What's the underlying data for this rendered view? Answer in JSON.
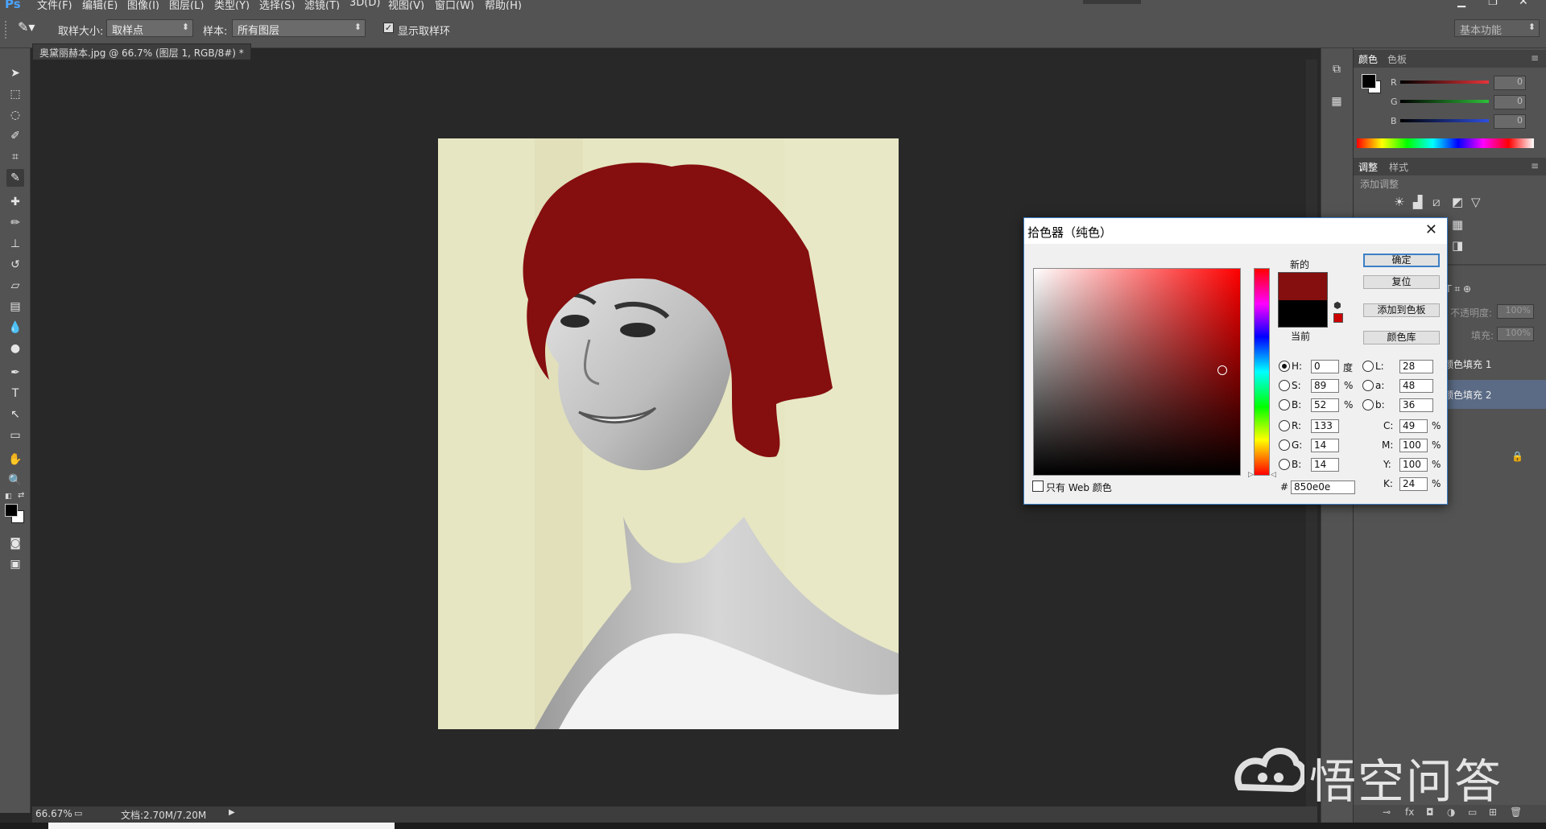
{
  "menu": {
    "logo": "Ps",
    "items": [
      "文件(F)",
      "编辑(E)",
      "图像(I)",
      "图层(L)",
      "类型(Y)",
      "选择(S)",
      "滤镜(T)",
      "3D(D)",
      "视图(V)",
      "窗口(W)",
      "帮助(H)"
    ]
  },
  "options": {
    "sample_size_label": "取样大小:",
    "sample_size_value": "取样点",
    "sample_label": "样本:",
    "sample_value": "所有图层",
    "show_ring_label": "显示取样环",
    "workspace": "基本功能"
  },
  "document": {
    "tab_title": "奥黛丽赫本.jpg @ 66.7% (图层 1, RGB/8#) *",
    "tab_close": "×",
    "zoom": "66.67%",
    "doc_info": "文档:2.70M/7.20M"
  },
  "color_panel": {
    "tabs": [
      "颜色",
      "色板"
    ],
    "channels": [
      {
        "label": "R",
        "value": "0",
        "color": "#e8343a"
      },
      {
        "label": "G",
        "value": "0",
        "color": "#2fbf3a"
      },
      {
        "label": "B",
        "value": "0",
        "color": "#2e4fe0"
      }
    ]
  },
  "adjust_panel": {
    "tabs": [
      "调整",
      "样式"
    ],
    "hint": "添加调整"
  },
  "layers_panel": {
    "opacity_label": "不透明度:",
    "opacity_value": "100%",
    "fill_label": "填充:",
    "fill_value": "100%",
    "layers": [
      "颜色填充 1",
      "颜色填充 2"
    ]
  },
  "color_picker": {
    "title": "拾色器（纯色）",
    "close": "✕",
    "new_label": "新的",
    "current_label": "当前",
    "new_color": "#850e0e",
    "current_color": "#000000",
    "buttons": {
      "ok": "确定",
      "reset": "复位",
      "add_swatch": "添加到色板",
      "libraries": "颜色库"
    },
    "hsb": [
      {
        "label": "H:",
        "value": "0",
        "unit": "度",
        "selected": true
      },
      {
        "label": "S:",
        "value": "89",
        "unit": "%",
        "selected": false
      },
      {
        "label": "B:",
        "value": "52",
        "unit": "%",
        "selected": false
      }
    ],
    "rgb": [
      {
        "label": "R:",
        "value": "133"
      },
      {
        "label": "G:",
        "value": "14"
      },
      {
        "label": "B:",
        "value": "14"
      }
    ],
    "lab": [
      {
        "label": "L:",
        "value": "28"
      },
      {
        "label": "a:",
        "value": "48"
      },
      {
        "label": "b:",
        "value": "36"
      }
    ],
    "cmyk": [
      {
        "label": "C:",
        "value": "49",
        "unit": "%"
      },
      {
        "label": "M:",
        "value": "100",
        "unit": "%"
      },
      {
        "label": "Y:",
        "value": "100",
        "unit": "%"
      },
      {
        "label": "K:",
        "value": "24",
        "unit": "%"
      }
    ],
    "web_only_label": "只有 Web 颜色",
    "hex_prefix": "#",
    "hex_value": "850e0e"
  },
  "watermark": {
    "text": "悟空问答"
  },
  "colors": {
    "hair": "#850e0e",
    "background": "#e6e6c2"
  }
}
